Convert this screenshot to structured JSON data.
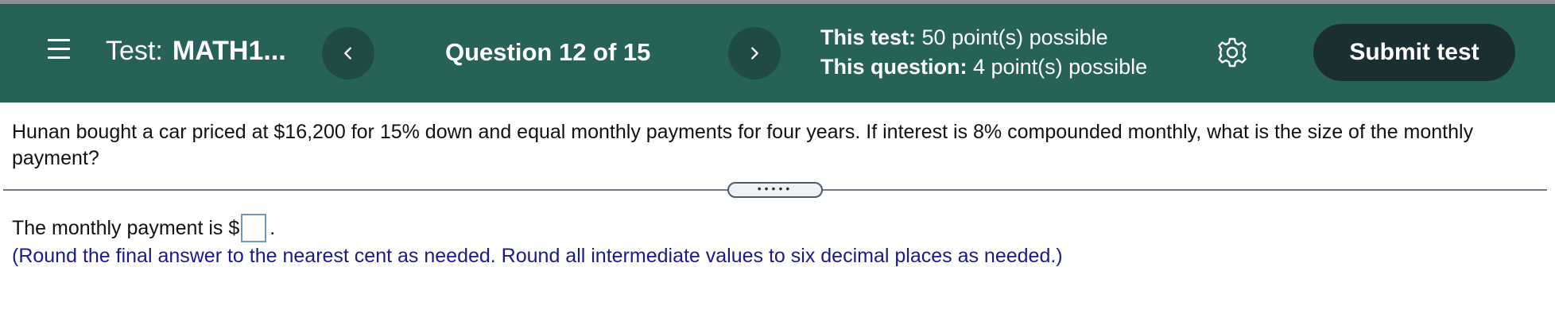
{
  "header": {
    "test_prefix": "Test:",
    "test_name": "MATH1...",
    "question_counter": "Question 12 of 15",
    "test_points_label": "This test:",
    "test_points_value": "50 point(s) possible",
    "question_points_label": "This question:",
    "question_points_value": "4 point(s) possible",
    "submit_label": "Submit test",
    "icons": {
      "menu": "menu-icon",
      "prev": "chevron-left-icon",
      "next": "chevron-right-icon",
      "settings": "gear-icon"
    }
  },
  "question": {
    "text": "Hunan bought a car priced at $16,200 for 15% down and equal monthly payments for four years. If interest is 8% compounded monthly, what is the size of the monthly payment?"
  },
  "answer": {
    "prefix": "The monthly payment is $",
    "suffix": ".",
    "value": "",
    "instruction": "(Round the final answer to the nearest cent as needed. Round all intermediate values to six decimal places as needed.)"
  },
  "colors": {
    "header_bg": "#276258",
    "nav_button_bg": "#1f4b44",
    "submit_bg": "#1b2f33",
    "instruction_text": "#1a1a8c"
  }
}
